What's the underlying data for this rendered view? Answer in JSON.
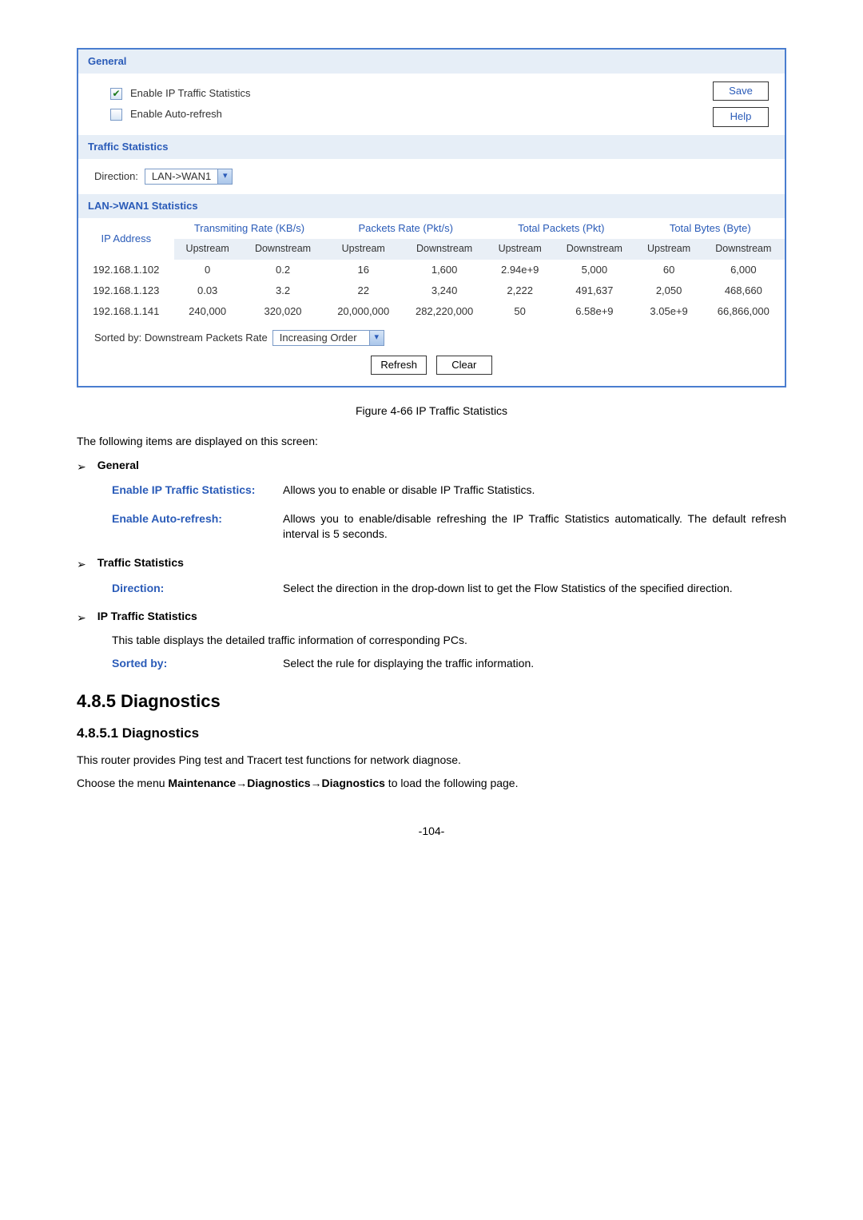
{
  "ui": {
    "general": {
      "header": "General",
      "enable_ip_traffic": {
        "label": "Enable IP Traffic Statistics",
        "checked": true
      },
      "enable_auto_refresh": {
        "label": "Enable Auto-refresh",
        "checked": false
      },
      "buttons": {
        "save": "Save",
        "help": "Help"
      }
    },
    "traffic_stats": {
      "header": "Traffic Statistics",
      "direction_label": "Direction:",
      "direction_value": "LAN->WAN1"
    },
    "lan_wan": {
      "header": "LAN->WAN1 Statistics",
      "col_ip": "IP Address",
      "grp_trans": "Transmiting Rate (KB/s)",
      "grp_packets": "Packets Rate (Pkt/s)",
      "grp_total_pkts": "Total Packets (Pkt)",
      "grp_total_bytes": "Total Bytes (Byte)",
      "sub_up": "Upstream",
      "sub_down": "Downstream",
      "rows": [
        {
          "ip": "192.168.1.102",
          "tu": "0",
          "td": "0.2",
          "pu": "16",
          "pd": "1,600",
          "tpu": "2.94e+9",
          "tpd": "5,000",
          "tbu": "60",
          "tbd": "6,000"
        },
        {
          "ip": "192.168.1.123",
          "tu": "0.03",
          "td": "3.2",
          "pu": "22",
          "pd": "3,240",
          "tpu": "2,222",
          "tpd": "491,637",
          "tbu": "2,050",
          "tbd": "468,660"
        },
        {
          "ip": "192.168.1.141",
          "tu": "240,000",
          "td": "320,020",
          "pu": "20,000,000",
          "pd": "282,220,000",
          "tpu": "50",
          "tpd": "6.58e+9",
          "tbu": "3.05e+9",
          "tbd": "66,866,000"
        }
      ],
      "sorted_by_label": "Sorted by: Downstream Packets Rate",
      "sort_order": "Increasing Order",
      "buttons": {
        "refresh": "Refresh",
        "clear": "Clear"
      }
    }
  },
  "doc": {
    "figure_caption": "Figure 4-66 IP Traffic Statistics",
    "intro": "The following items are displayed on this screen:",
    "sections": {
      "general": {
        "title": "General",
        "items": [
          {
            "term": "Enable IP Traffic Statistics:",
            "desc": "Allows you to enable or disable IP Traffic Statistics."
          },
          {
            "term": "Enable Auto-refresh:",
            "desc": "Allows you to enable/disable refreshing the IP Traffic Statistics automatically. The default refresh interval is 5 seconds."
          }
        ]
      },
      "traffic": {
        "title": "Traffic Statistics",
        "items": [
          {
            "term": "Direction:",
            "desc": "Select the direction in the drop-down list to get the Flow Statistics of the specified direction."
          }
        ]
      },
      "iptraffic": {
        "title": "IP Traffic Statistics",
        "paragraph": "This table displays the detailed traffic information of corresponding PCs.",
        "items": [
          {
            "term": "Sorted by:",
            "desc": "Select the rule for displaying the traffic information."
          }
        ]
      }
    },
    "h485": "4.8.5   Diagnostics",
    "h4851": "4.8.5.1    Diagnostics",
    "diag_p1": "This router provides Ping test and Tracert test functions for network diagnose.",
    "diag_p2_pre": "Choose the menu ",
    "diag_p2_bold": "Maintenance→Diagnostics→Diagnostics",
    "diag_p2_post": " to load the following page.",
    "page_number": "-104-"
  }
}
